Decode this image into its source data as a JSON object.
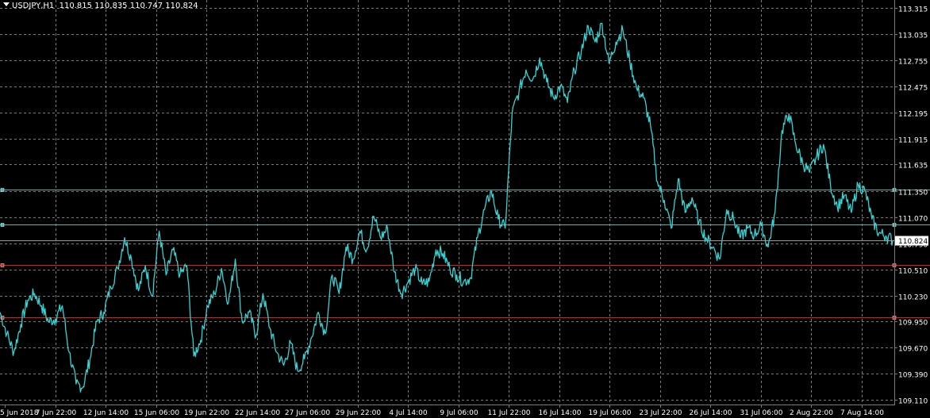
{
  "header": {
    "symbol_timeframe": "USDJPY,H1",
    "ohlc": "110.815 110.835 110.747 110.824"
  },
  "colors": {
    "background": "#000000",
    "grid": "#7a7a7a",
    "price_line": "#34d4d4",
    "axis_text": "#ffffff",
    "cyan_level": "#2fbfbf",
    "red_level": "#d62020",
    "current_price_box_bg": "#ffffff",
    "current_price_box_text": "#000000"
  },
  "chart_data": {
    "type": "line",
    "title": "",
    "price_axis_labels": [
      "113.315",
      "113.035",
      "112.755",
      "112.475",
      "112.195",
      "111.915",
      "111.635",
      "111.350",
      "111.070",
      "110.790",
      "110.510",
      "110.230",
      "109.950",
      "109.670",
      "109.390",
      "109.110"
    ],
    "time_axis_labels": [
      "5 Jun 2018",
      "7 Jun 22:00",
      "12 Jun 14:00",
      "15 Jun 06:00",
      "19 Jun 22:00",
      "22 Jun 14:00",
      "27 Jun 06:00",
      "29 Jun 22:00",
      "4 Jul 14:00",
      "9 Jul 06:00",
      "11 Jul 22:00",
      "16 Jul 14:00",
      "19 Jul 06:00",
      "23 Jul 22:00",
      "26 Jul 14:00",
      "31 Jul 06:00",
      "2 Aug 22:00",
      "7 Aug 14:00"
    ],
    "ylim": [
      109.06,
      113.4
    ],
    "current_price": "110.824",
    "horizontal_levels": [
      {
        "price": 111.37,
        "color": "cyan"
      },
      {
        "price": 110.99,
        "color": "cyan"
      },
      {
        "price": 110.555,
        "color": "red"
      },
      {
        "price": 109.995,
        "color": "red"
      }
    ],
    "series": [
      {
        "values": [
          110.05,
          109.82,
          109.62,
          109.92,
          110.18,
          110.25,
          110.12,
          109.95,
          109.98,
          110.12,
          109.62,
          109.28,
          109.25,
          109.55,
          109.95,
          110.05,
          110.32,
          110.52,
          110.85,
          110.62,
          110.28,
          110.55,
          110.22,
          110.92,
          110.45,
          110.72,
          110.45,
          110.55,
          109.58,
          109.75,
          110.12,
          110.25,
          110.52,
          110.15,
          110.62,
          109.95,
          110.05,
          109.8,
          110.25,
          109.88,
          109.62,
          109.48,
          109.72,
          109.42,
          109.55,
          109.78,
          110.05,
          109.82,
          110.45,
          110.25,
          110.75,
          110.62,
          110.92,
          110.72,
          111.08,
          110.85,
          110.95,
          110.48,
          110.25,
          110.38,
          110.52,
          110.35,
          110.38,
          110.72,
          110.68,
          110.52,
          110.45,
          110.38,
          110.42,
          110.85,
          111.15,
          111.35,
          111.05,
          110.95,
          112.18,
          112.42,
          112.65,
          112.55,
          112.78,
          112.52,
          112.35,
          112.48,
          112.3,
          112.65,
          112.85,
          113.12,
          112.95,
          113.15,
          112.72,
          112.95,
          113.08,
          112.75,
          112.45,
          112.35,
          112.05,
          111.45,
          111.25,
          110.95,
          111.48,
          111.12,
          111.28,
          111.02,
          110.85,
          110.75,
          110.62,
          111.15,
          111.05,
          110.85,
          110.95,
          110.88,
          110.98,
          110.75,
          111.12,
          112.0,
          112.18,
          111.85,
          111.65,
          111.55,
          111.72,
          111.85,
          111.42,
          111.18,
          111.3,
          111.12,
          111.42,
          111.35,
          111.05,
          110.9,
          110.87,
          110.824
        ]
      }
    ]
  }
}
